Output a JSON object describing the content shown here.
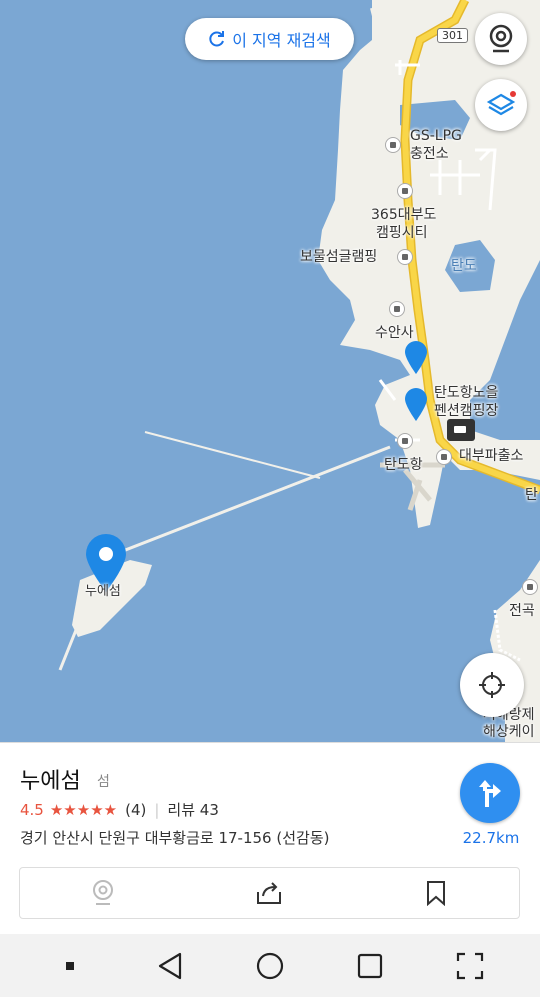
{
  "map": {
    "search_area_label": "이 지역 재검색",
    "route_number": "301",
    "labels": {
      "gs_lpg_1": "GS-LPG",
      "gs_lpg_2": "충전소",
      "camping_365_1": "365대부도",
      "camping_365_2": "캠핑시티",
      "glamping": "보물섬글램핑",
      "tando": "탄도",
      "suansa": "수안사",
      "pension_1": "탄도항노을",
      "pension_2": "펜션캠핑장",
      "police": "대부파출소",
      "port": "탄도항",
      "island": "누에섬",
      "jeongok": "전곡",
      "tan_edge": "탄",
      "marine_1": "서해랑제",
      "marine_2": "해상케이"
    },
    "icons": [
      "search-area-refresh-icon",
      "street-view-icon",
      "layers-icon",
      "current-location-icon"
    ]
  },
  "place": {
    "name": "누에섬",
    "category": "섬",
    "rating": "4.5",
    "stars": "★★★★★",
    "review_count": "(4)",
    "review_label": "리뷰 43",
    "address": "경기 안산시 단원구 대부황금로 17-156 (선감동)",
    "distance": "22.7km"
  },
  "colors": {
    "sea": "#7ba7d3",
    "land": "#f1f0ea",
    "road": "#f5cf3b",
    "accent": "#1b73e8",
    "pin": "#1e88e5",
    "rating": "#e8543f"
  }
}
